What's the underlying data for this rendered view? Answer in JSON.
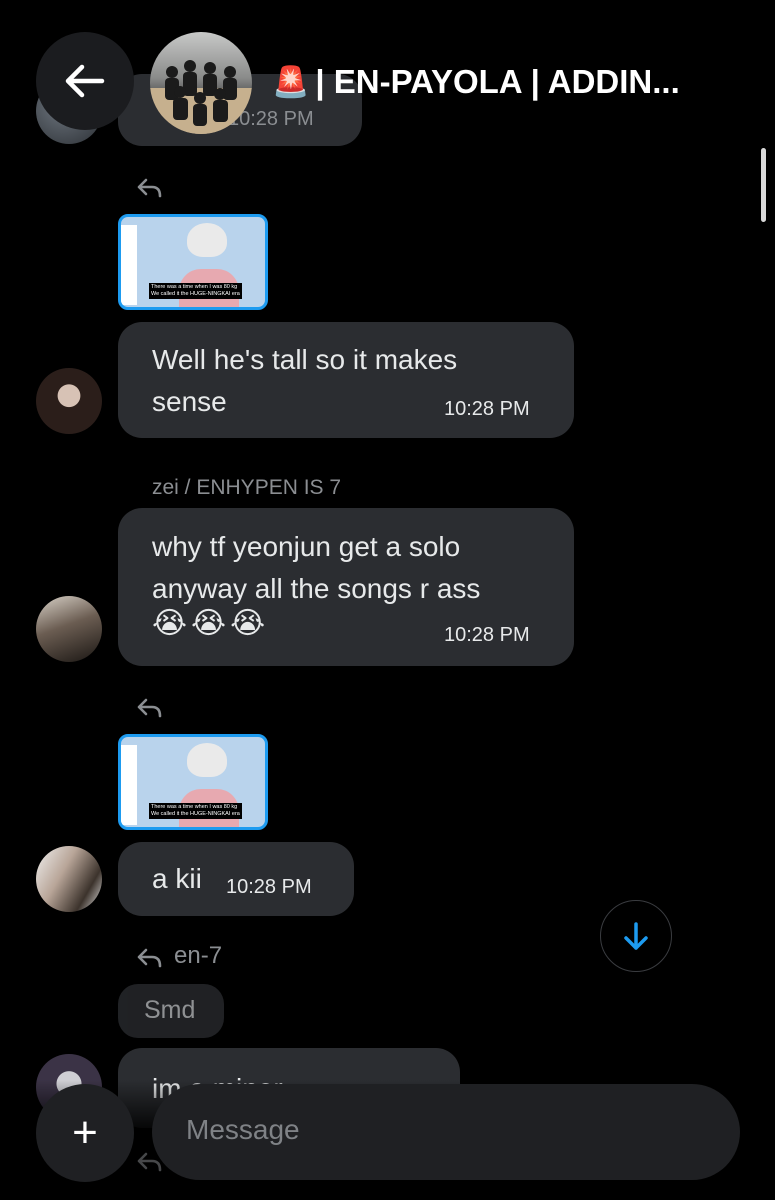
{
  "header": {
    "group_title": "| EN-PAYOLA | ADDIN...",
    "alarm_emoji": "🚨"
  },
  "messages": [
    {
      "time": "10:28 PM"
    },
    {
      "text": "Well he's tall so it makes\nsense",
      "time": "10:28 PM",
      "thumb_caption": "There was a time when I was 80 kg\nWe called it the HUGE-NINGKAI era"
    },
    {
      "sender": "zei / ENHYPEN IS 7",
      "text": "why tf yeonjun get a solo\nanyway all the songs r ass",
      "emojis": "😭😭😭",
      "time": "10:28 PM"
    },
    {
      "text": "a kii",
      "time": "10:28 PM",
      "thumb_caption": "There was a time when I was 80 kg\nWe called it the HUGE-NINGKAI era"
    },
    {
      "reply_to": "en-7",
      "quoted": "Smd",
      "text": "im a minor"
    }
  ],
  "composer": {
    "placeholder": "Message",
    "add_label": "+"
  },
  "colors": {
    "accent": "#1d9bf0",
    "bubble": "#2b2d31",
    "background": "#000000"
  }
}
